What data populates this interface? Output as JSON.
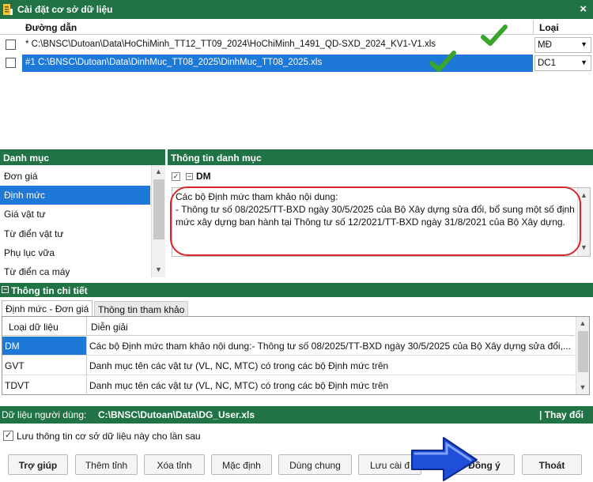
{
  "window": {
    "title": "Cài đặt cơ sở dữ liệu",
    "close_glyph": "×",
    "title_icon": "database-icon"
  },
  "files": {
    "col_path": "Đường dẫn",
    "col_type": "Loại",
    "rows": [
      {
        "path": "* C:\\BNSC\\Dutoan\\Data\\HoChiMinh_TT12_TT09_2024\\HoChiMinh_1491_QD-SXD_2024_KV1-V1.xls",
        "type": "MĐ",
        "selected": false
      },
      {
        "path": "#1  C:\\BNSC\\Dutoan\\Data\\DinhMuc_TT08_2025\\DinhMuc_TT08_2025.xls",
        "type": "DC1",
        "selected": true
      }
    ]
  },
  "catalog": {
    "header": "Danh mục",
    "items": [
      "Đơn giá",
      "Định mức",
      "Giá vật tư",
      "Từ điển vật tư",
      "Phụ lục vữa",
      "Từ điển ca máy"
    ],
    "selected_index": 1
  },
  "catalog_info": {
    "header": "Thông tin danh mục",
    "node_label": "DM",
    "description": "Các bộ Định mức tham khảo nội dung:\n- Thông tư số 08/2025/TT-BXD ngày 30/5/2025 của Bộ Xây dựng sửa đổi, bổ sung một số định mức xây dựng ban hành tại Thông tư số 12/2021/TT-BXD ngày 31/8/2021 của Bộ Xây dựng."
  },
  "detail": {
    "header": "Thông tin chi tiết",
    "tabs": [
      "Định mức - Đơn giá",
      "Thông tin tham khảo"
    ],
    "active_tab": 0,
    "columns": [
      "Loại dữ liệu",
      "Diễn giải"
    ],
    "rows": [
      {
        "type": "DM",
        "desc": "Các bộ Định mức tham khảo nội dung:- Thông tư số 08/2025/TT-BXD ngày 30/5/2025 của Bộ Xây dựng sửa đổi,...",
        "selected": true
      },
      {
        "type": "GVT",
        "desc": "Danh mục tên các vật tư (VL, NC, MTC) có trong các bộ Định mức trên",
        "selected": false
      },
      {
        "type": "TDVT",
        "desc": "Danh mục tên các vật tư (VL, NC, MTC) có trong các bộ Định mức trên",
        "selected": false
      }
    ]
  },
  "user_data": {
    "label": "Dữ liệu người dùng:",
    "path": "C:\\BNSC\\Dutoan\\Data\\DG_User.xls",
    "change_label": "| Thay đổi"
  },
  "save_option": {
    "label": "Lưu thông tin cơ sở dữ liệu này cho lần sau",
    "checked": true
  },
  "buttons": {
    "help": "Trợ giúp",
    "add_province": "Thêm tỉnh",
    "delete_province": "Xóa tỉnh",
    "default": "Mặc định",
    "shared": "Dùng chung",
    "save_as": "Lưu cài đ",
    "ok": "Đồng ý",
    "exit": "Thoát"
  },
  "colors": {
    "accent_green": "#217346",
    "selection_blue": "#1e78d7",
    "annotation_red": "#d9262b",
    "check_green": "#3aa52b",
    "arrow_blue": "#1f4ed8"
  }
}
